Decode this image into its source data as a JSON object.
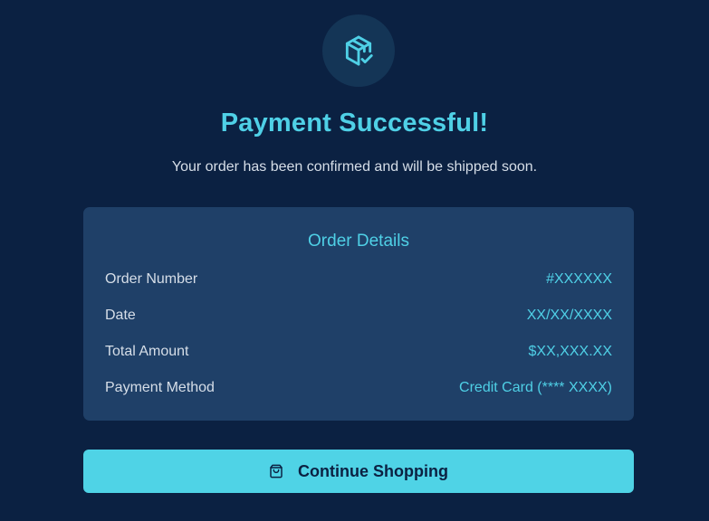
{
  "hero": {
    "icon": "package-check-icon",
    "title": "Payment Successful!",
    "subtitle": "Your order has been confirmed and will be shipped soon."
  },
  "order_details": {
    "heading": "Order Details",
    "rows": [
      {
        "label": "Order Number",
        "value": "#XXXXXX"
      },
      {
        "label": "Date",
        "value": "XX/XX/XXXX"
      },
      {
        "label": "Total Amount",
        "value": "$XX,XXX.XX"
      },
      {
        "label": "Payment Method",
        "value": "Credit Card (**** XXXX)"
      }
    ]
  },
  "action": {
    "icon": "shopping-bag-icon",
    "label": "Continue Shopping"
  },
  "colors": {
    "background": "#0b2142",
    "accent": "#4fd0e6",
    "card": "#1f4068",
    "button": "#4fd3e6"
  }
}
